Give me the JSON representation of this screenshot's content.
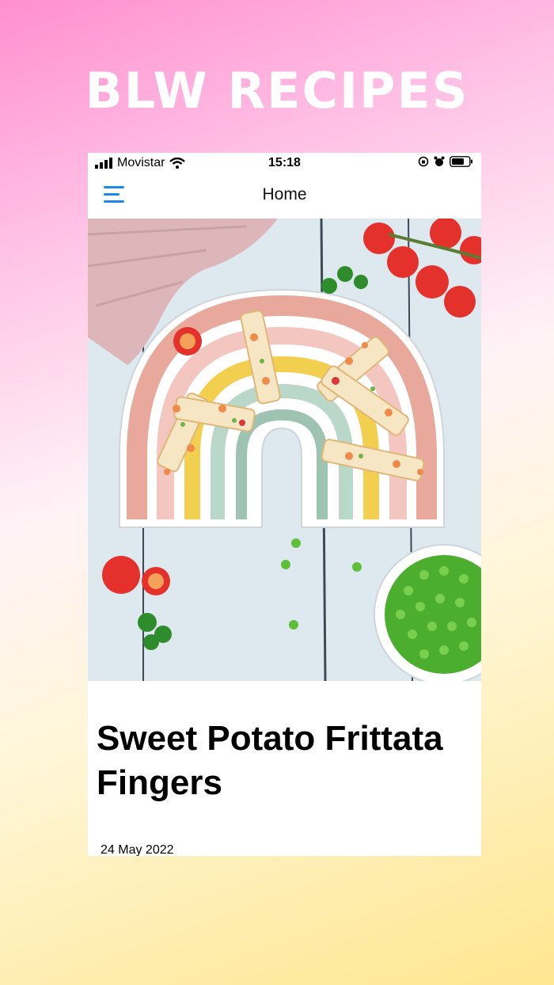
{
  "banner": {
    "title": "BLW RECIPES"
  },
  "status_bar": {
    "carrier": "Movistar",
    "time": "15:18"
  },
  "nav": {
    "title": "Home",
    "menu_icon": "hamburger-menu-icon"
  },
  "hero": {
    "image_subject": "sweet-potato-frittata-photo"
  },
  "recipe": {
    "title": "Sweet Potato Frittata Fingers",
    "date": "24 May 2022"
  },
  "colors": {
    "accent": "#1e88e5",
    "banner_text": "#ffffff"
  }
}
